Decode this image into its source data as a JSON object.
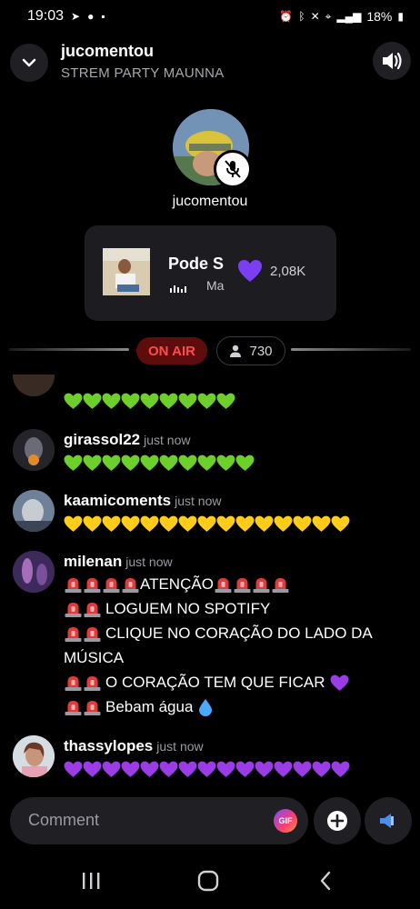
{
  "status_bar": {
    "time": "19:03",
    "battery": "18%"
  },
  "header": {
    "title": "jucomentou",
    "subtitle": "STREM PARTY MAUNNA"
  },
  "host": {
    "name": "jucomentou"
  },
  "music": {
    "song_title": "Pode S",
    "artist": "Ma",
    "likes": "2,08K"
  },
  "live": {
    "on_air_label": "ON AIR",
    "viewers": "730"
  },
  "chat": {
    "messages": [
      {
        "user": "",
        "time": "",
        "lines": [
          "💚💚💚💚💚💚💚💚💚"
        ]
      },
      {
        "user": "girassol22",
        "time": "just now",
        "lines": [
          "💚💚💚💚💚💚💚💚💚💚"
        ]
      },
      {
        "user": "kaamicoments",
        "time": "just now",
        "lines": [
          "💛💛💛💛💛💛💛💛💛💛💛💛💛💛💛"
        ]
      },
      {
        "user": "milenan",
        "time": "just now",
        "lines": [
          "ATENÇÃO",
          "LOGUEM NO SPOTIFY",
          "CLIQUE NO CORAÇÃO DO LADO DA",
          "MÚSICA",
          "O CORAÇÃO TEM QUE FICAR",
          "Bebam água"
        ]
      },
      {
        "user": "thassylopes",
        "time": "just now",
        "lines": [
          "💜💜💜💜💜💜💜💜💜💜💜💜💜💜💜"
        ]
      }
    ]
  },
  "composer": {
    "placeholder": "Comment",
    "gif_label": "GIF"
  },
  "colors": {
    "on_air_bg": "#5e0c0c",
    "on_air_text": "#ff4b4b",
    "heart_green": "#6ccf2a",
    "heart_yellow": "#ffcc1a",
    "heart_purple": "#9b3de6",
    "like_purple": "#7b3ff2"
  }
}
